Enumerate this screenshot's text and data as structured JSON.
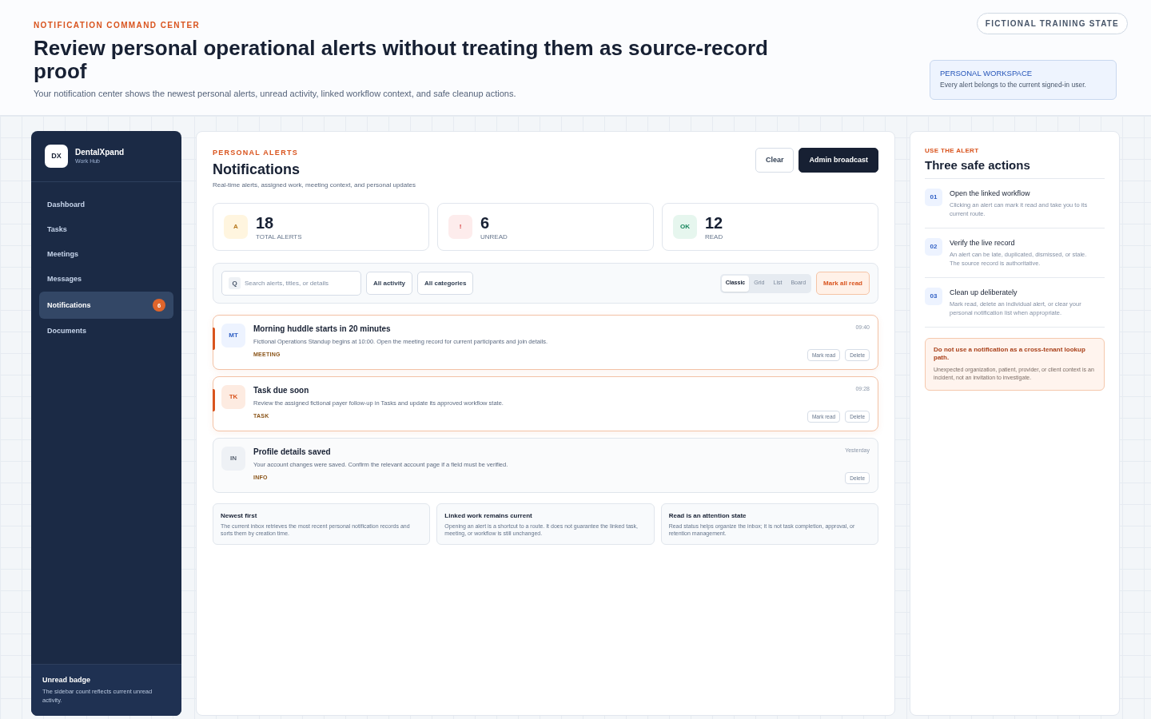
{
  "header": {
    "kicker": "NOTIFICATION COMMAND CENTER",
    "title": "Review personal operational alerts without treating them as source-record proof",
    "subtitle": "Your notification center shows the newest personal alerts, unread activity, linked workflow context, and safe cleanup actions.",
    "state_badge": "FICTIONAL TRAINING STATE",
    "workspace_note": {
      "title": "PERSONAL WORKSPACE",
      "text": "Every alert belongs to the current signed-in user."
    }
  },
  "sidebar": {
    "logo": "DX",
    "brand": "DentalXpand",
    "subtitle": "Work Hub",
    "items": [
      {
        "label": "Dashboard",
        "selected": false
      },
      {
        "label": "Tasks",
        "selected": false
      },
      {
        "label": "Meetings",
        "selected": false
      },
      {
        "label": "Messages",
        "selected": false
      },
      {
        "label": "Notifications",
        "selected": true,
        "badge": "6"
      },
      {
        "label": "Documents",
        "selected": false
      }
    ],
    "footer": {
      "title": "Unread badge",
      "text": "The sidebar count reflects current unread activity."
    }
  },
  "main": {
    "kicker": "PERSONAL ALERTS",
    "title": "Notifications",
    "subtitle": "Real-time alerts, assigned work, meeting context, and personal updates",
    "buttons": [
      {
        "label": "Clear",
        "kind": "secondary"
      },
      {
        "label": "Admin broadcast",
        "kind": "primary"
      }
    ],
    "stats": [
      {
        "icon": "A",
        "value": "18",
        "label": "TOTAL ALERTS",
        "kind": "total"
      },
      {
        "icon": "!",
        "value": "6",
        "label": "UNREAD",
        "kind": "unread"
      },
      {
        "icon": "OK",
        "value": "12",
        "label": "READ",
        "kind": "read"
      }
    ],
    "toolbar": {
      "search": {
        "icon": "Q",
        "placeholder": "Search alerts, titles, or details"
      },
      "filters": [
        "All activity",
        "All categories"
      ],
      "views": [
        {
          "label": "Classic",
          "selected": true
        },
        {
          "label": "Grid",
          "selected": false
        },
        {
          "label": "List",
          "selected": false
        },
        {
          "label": "Board",
          "selected": false
        }
      ],
      "mark_all": "Mark all read"
    },
    "notifications": [
      {
        "avatar": "MT",
        "kind": "meeting",
        "title": "Morning huddle starts in 20 minutes",
        "text": "Fictional Operations Standup begins at 10:00. Open the meeting record for current participants and join details.",
        "category": "MEETING",
        "time": "09:40",
        "unread": true,
        "actions": [
          "Mark read",
          "Delete"
        ]
      },
      {
        "avatar": "TK",
        "kind": "task",
        "title": "Task due soon",
        "text": "Review the assigned fictional payer follow-up in Tasks and update its approved workflow state.",
        "category": "TASK",
        "time": "09:28",
        "unread": true,
        "actions": [
          "Mark read",
          "Delete"
        ]
      },
      {
        "avatar": "IN",
        "kind": "info",
        "title": "Profile details saved",
        "text": "Your account changes were saved. Confirm the relevant account page if a field must be verified.",
        "category": "INFO",
        "time": "Yesterday",
        "unread": false,
        "actions": [
          "Delete"
        ]
      }
    ],
    "notes": [
      {
        "title": "Newest first",
        "text": "The current inbox retrieves the most recent personal notification records and sorts them by creation time."
      },
      {
        "title": "Linked work remains current",
        "text": "Opening an alert is a shortcut to a route. It does not guarantee the linked task, meeting, or workflow is still unchanged."
      },
      {
        "title": "Read is an attention state",
        "text": "Read status helps organize the inbox; it is not task completion, approval, or retention management."
      }
    ]
  },
  "guide": {
    "kicker": "USE THE ALERT",
    "title": "Three safe actions",
    "steps": [
      {
        "number": "01",
        "title": "Open the linked workflow",
        "text": "Clicking an alert can mark it read and take you to its current route."
      },
      {
        "number": "02",
        "title": "Verify the live record",
        "text": "An alert can be late, duplicated, dismissed, or stale. The source record is authoritative."
      },
      {
        "number": "03",
        "title": "Clean up deliberately",
        "text": "Mark read, delete an individual alert, or clear your personal notification list when appropriate."
      }
    ],
    "warning": {
      "title": "Do not use a notification as a cross-tenant lookup path.",
      "text": "Unexpected organization, patient, provider, or client context is an incident, not an invitation to investigate."
    }
  }
}
